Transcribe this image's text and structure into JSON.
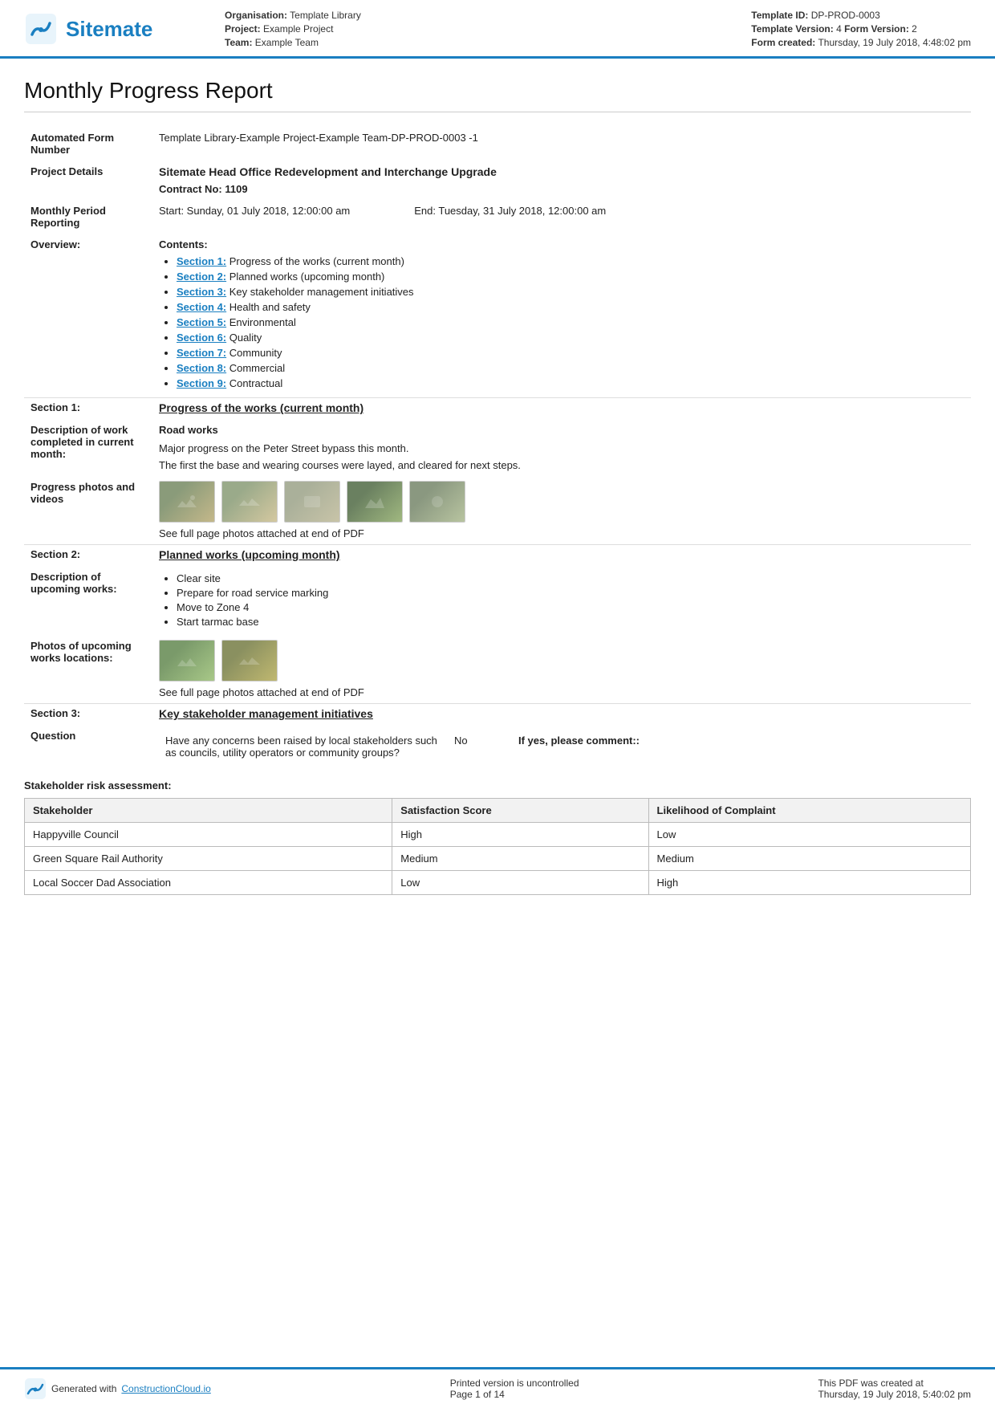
{
  "header": {
    "logo_text": "Sitemate",
    "organisation_label": "Organisation:",
    "organisation_value": "Template Library",
    "project_label": "Project:",
    "project_value": "Example Project",
    "team_label": "Team:",
    "team_value": "Example Team",
    "template_id_label": "Template ID:",
    "template_id_value": "DP-PROD-0003",
    "template_version_label": "Template Version:",
    "template_version_value": "4",
    "form_version_label": "Form Version:",
    "form_version_value": "2",
    "form_created_label": "Form created:",
    "form_created_value": "Thursday, 19 July 2018, 4:48:02 pm"
  },
  "report": {
    "title": "Monthly Progress Report",
    "automated_form_number_label": "Automated Form Number",
    "automated_form_number_value": "Template Library-Example Project-Example Team-DP-PROD-0003   -1",
    "project_details_label": "Project Details",
    "project_details_value": "Sitemate Head Office Redevelopment and Interchange Upgrade",
    "contract_no_label": "Contract No:",
    "contract_no_value": "1109",
    "monthly_period_label": "Monthly Period Reporting",
    "period_start": "Start: Sunday, 01 July 2018, 12:00:00 am",
    "period_end": "End: Tuesday, 31 July 2018, 12:00:00 am",
    "overview_label": "Overview:",
    "contents_label": "Contents:"
  },
  "contents": {
    "items": [
      {
        "link": "Section 1:",
        "text": "Progress of the works (current month)"
      },
      {
        "link": "Section 2:",
        "text": "Planned works (upcoming month)"
      },
      {
        "link": "Section 3:",
        "text": "Key stakeholder management initiatives"
      },
      {
        "link": "Section 4:",
        "text": "Health and safety"
      },
      {
        "link": "Section 5:",
        "text": "Environmental"
      },
      {
        "link": "Section 6:",
        "text": "Quality"
      },
      {
        "link": "Section 7:",
        "text": "Community"
      },
      {
        "link": "Section 8:",
        "text": "Commercial"
      },
      {
        "link": "Section 9:",
        "text": "Contractual"
      }
    ]
  },
  "section1": {
    "label": "Section 1:",
    "title": "Progress of the works (current month)",
    "work_label": "Description of work completed in current month:",
    "work_subtitle": "Road works",
    "work_text1": "Major progress on the Peter Street bypass this month.",
    "work_text2": "The first the base and wearing courses were layed, and cleared for next steps.",
    "photos_label": "Progress photos and videos",
    "photos_caption": "See full page photos attached at end of PDF"
  },
  "section2": {
    "label": "Section 2:",
    "title": "Planned works (upcoming month)",
    "upcoming_label": "Description of upcoming works:",
    "upcoming_items": [
      "Clear site",
      "Prepare for road service marking",
      "Move to Zone 4",
      "Start tarmac base"
    ],
    "photos_label": "Photos of upcoming works locations:",
    "photos_caption": "See full page photos attached at end of PDF"
  },
  "section3": {
    "label": "Section 3:",
    "title": "Key stakeholder management initiatives",
    "question_label": "Question",
    "question_text": "Have any concerns been raised by local stakeholders such as councils, utility operators or community groups?",
    "question_answer": "No",
    "question_if_yes": "If yes, please comment::",
    "stakeholder_section_label": "Stakeholder risk assessment:",
    "table_headers": [
      "Stakeholder",
      "Satisfaction Score",
      "Likelihood of Complaint"
    ],
    "table_rows": [
      {
        "stakeholder": "Happyville Council",
        "satisfaction": "High",
        "likelihood": "Low"
      },
      {
        "stakeholder": "Green Square Rail Authority",
        "satisfaction": "Medium",
        "likelihood": "Medium"
      },
      {
        "stakeholder": "Local Soccer Dad Association",
        "satisfaction": "Low",
        "likelihood": "High"
      }
    ]
  },
  "footer": {
    "generated_text": "Generated with",
    "link_text": "ConstructionCloud.io",
    "printed_text": "Printed version is uncontrolled",
    "page_text": "Page 1 of 14",
    "pdf_created_text": "This PDF was created at",
    "pdf_created_date": "Thursday, 19 July 2018, 5:40:02 pm"
  }
}
